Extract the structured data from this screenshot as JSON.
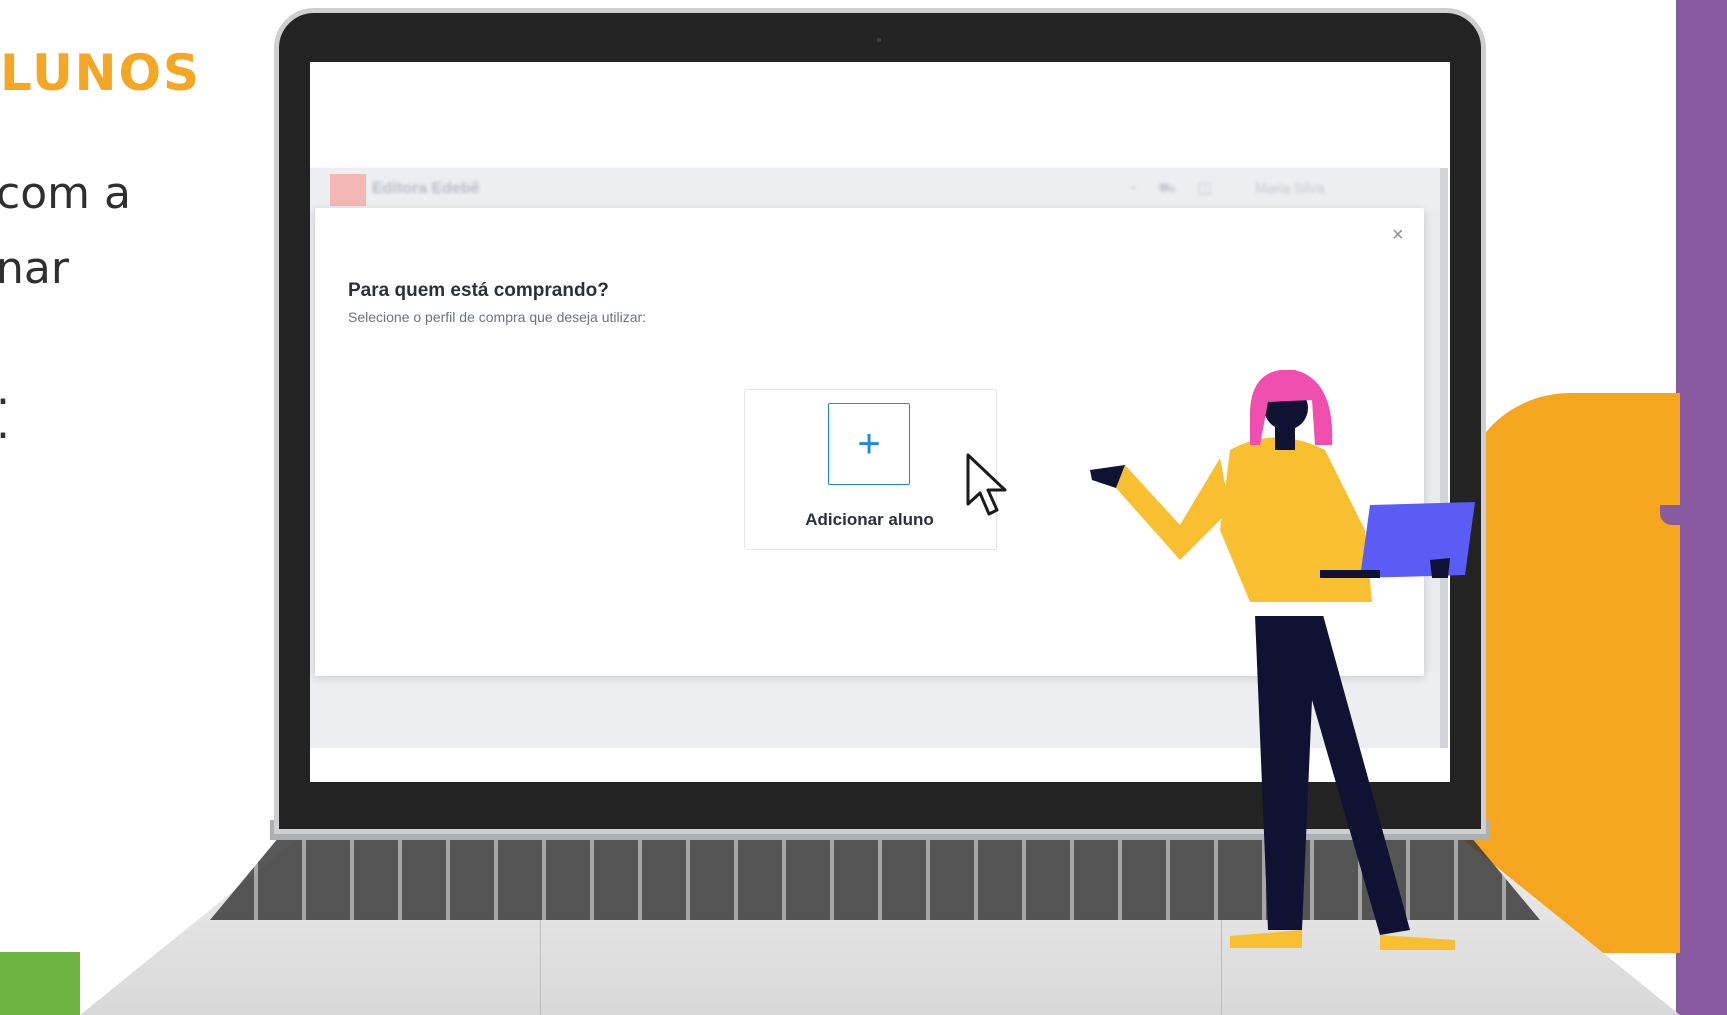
{
  "slide": {
    "heading": "LUNOS",
    "body_lines": [
      "com a",
      "nar",
      ".",
      "."
    ]
  },
  "app": {
    "brand": "Editora Edebê",
    "user_name": "Maria Silva"
  },
  "dialog": {
    "title": "Para quem está comprando?",
    "subtitle": "Selecione o perfil de compra que deseja utilizar:",
    "close_glyph": "×",
    "add_card": {
      "icon": "plus-icon",
      "icon_glyph": "+",
      "label": "Adicionar aluno"
    }
  },
  "colors": {
    "heading_orange": "#f5a623",
    "accent_blue": "#1e88e5",
    "purple_bar": "#8a5aa0",
    "orange_blob": "#f6a61e",
    "person_hair": "#f04fb0",
    "person_shirt": "#f8c030",
    "laptop_screen_blue": "#5a5cf5"
  }
}
